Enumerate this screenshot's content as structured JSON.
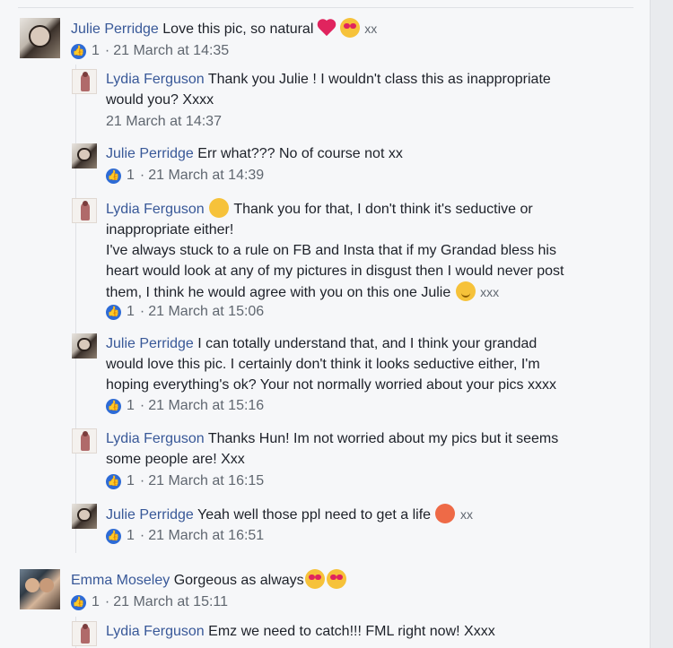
{
  "comments": [
    {
      "name": "Julie Perridge",
      "text": "Love this pic, so natural",
      "after_emoji": "xx",
      "likes": "1",
      "time": "21 March at 14:35"
    },
    {
      "name": "Lydia Ferguson",
      "text_line1": "Thank you Julie ! I wouldn't class this as inappropriate",
      "text_line2": "would you? Xxxx",
      "time": "21 March at 14:37"
    },
    {
      "name": "Julie Perridge",
      "text": "Err what??? No of course not xx",
      "likes": "1",
      "time": "21 March at 14:39"
    },
    {
      "name": "Lydia Ferguson",
      "text_line1": "Thank you for that, I don't think it's seductive or",
      "text_line2": "inappropriate either!",
      "text_line3": "I've always stuck to a rule on FB and Insta that if my Grandad bless his",
      "text_line4": "heart would look at any of my pictures in disgust then I would never post",
      "text_line5": "them, I think he would agree with you on this one Julie",
      "after_emoji": "xxx",
      "likes": "1",
      "time": "21 March at 15:06"
    },
    {
      "name": "Julie Perridge",
      "text_line1": "I can totally understand that, and I think your grandad",
      "text_line2": "would love this pic. I certainly don't think it looks seductive either, I'm",
      "text_line3": "hoping everything's ok? Your not normally worried about your pics xxxx",
      "likes": "1",
      "time": "21 March at 15:16"
    },
    {
      "name": "Lydia Ferguson",
      "text_line1": "Thanks Hun! Im not worried about my pics but it seems",
      "text_line2": "some people are! Xxx",
      "likes": "1",
      "time": "21 March at 16:15"
    },
    {
      "name": "Julie Perridge",
      "text": "Yeah well those ppl need to get a life",
      "after_emoji": "xx",
      "likes": "1",
      "time": "21 March at 16:51"
    },
    {
      "name": "Emma Moseley",
      "text": "Gorgeous as always",
      "likes": "1",
      "time": "21 March at 15:11"
    },
    {
      "name": "Lydia Ferguson",
      "text": "Emz we need to catch!!! FML right now! Xxxx"
    }
  ],
  "separator": "·",
  "icons": {
    "like": "thumbs-up-icon",
    "heart": "red-heart-emoji",
    "heart_eyes": "heart-eyes-emoji",
    "kiss": "kissing-wink-emoji",
    "smile": "smiling-face-emoji",
    "angry": "angry-face-emoji"
  },
  "colors": {
    "name": "#385898",
    "like_badge": "#2d6bd6",
    "meta": "#606770"
  }
}
